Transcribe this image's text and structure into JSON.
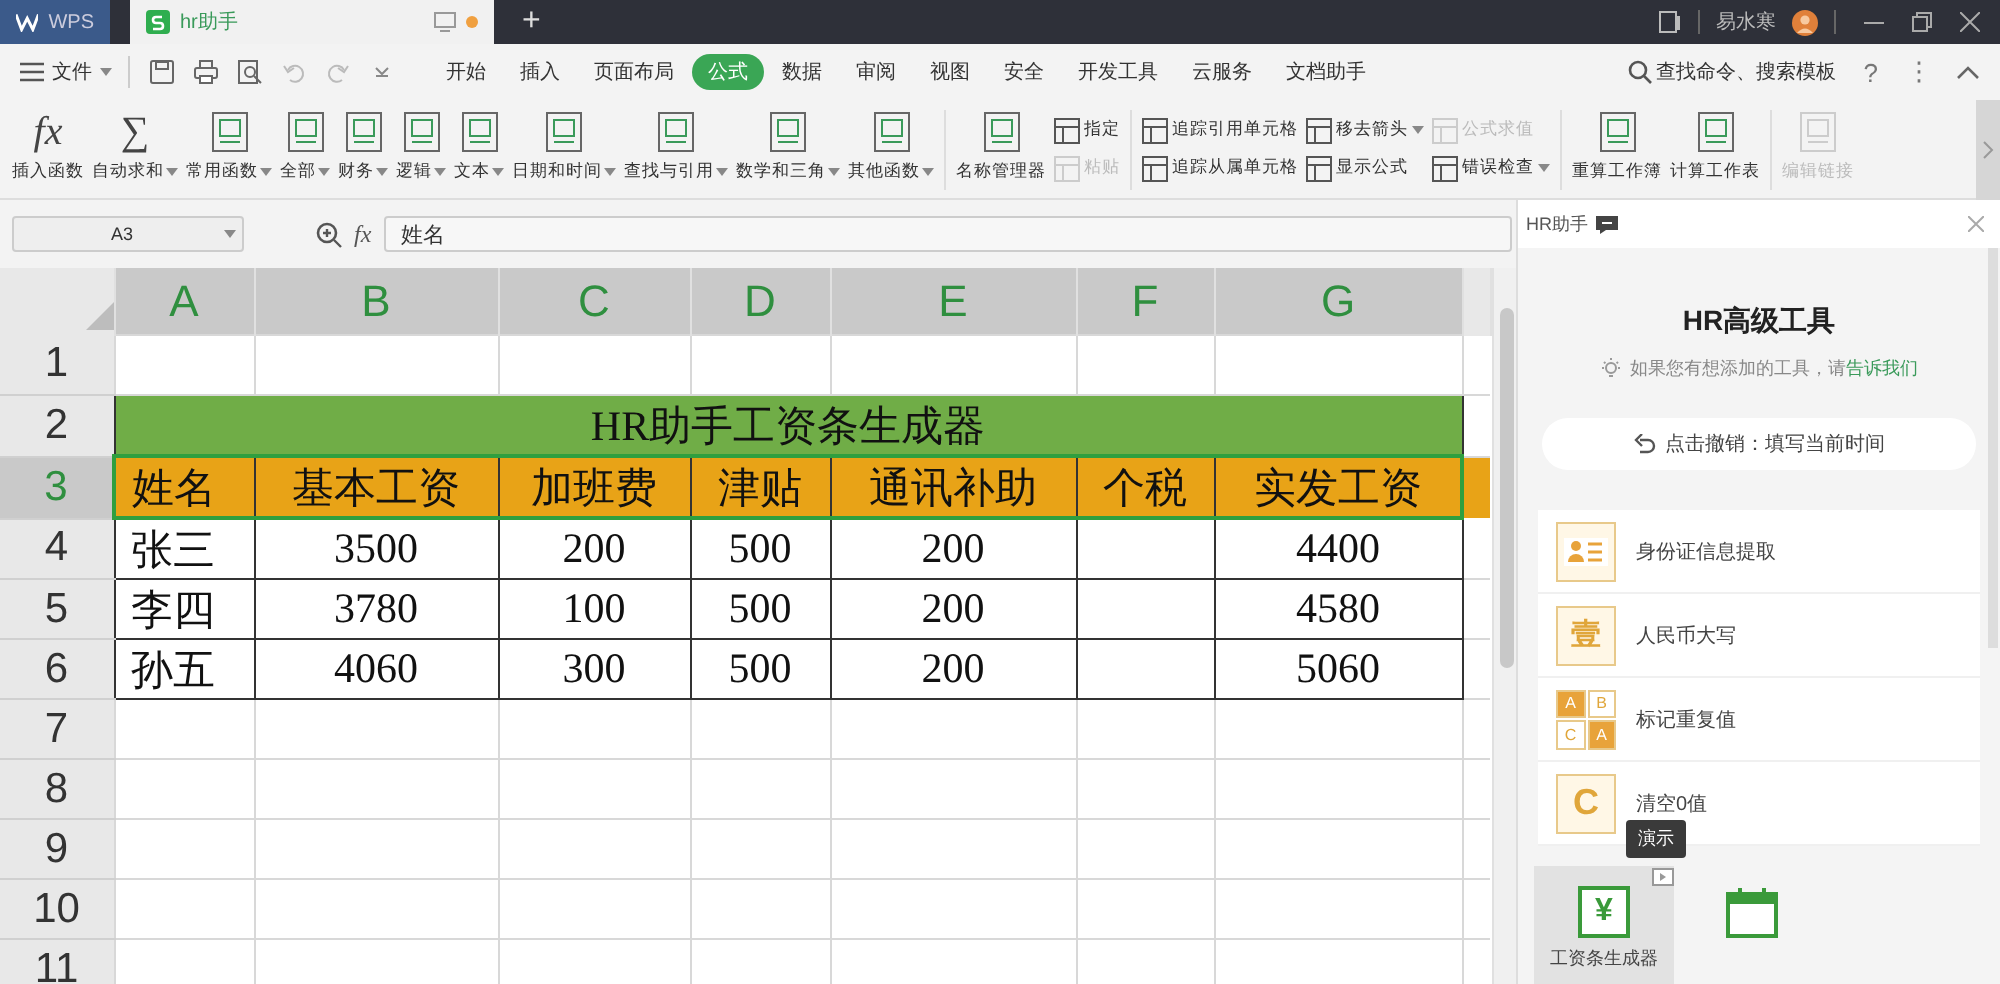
{
  "title_bar": {
    "tabs": [
      {
        "label": "WPS",
        "selected": false
      },
      {
        "label": "hr助手",
        "selected": true
      }
    ],
    "new_tab": "+",
    "user": "易水寒"
  },
  "menu": {
    "file": "文件",
    "tabs": [
      {
        "label": "开始",
        "selected": false
      },
      {
        "label": "插入",
        "selected": false
      },
      {
        "label": "页面布局",
        "selected": false
      },
      {
        "label": "公式",
        "selected": true
      },
      {
        "label": "数据",
        "selected": false
      },
      {
        "label": "审阅",
        "selected": false
      },
      {
        "label": "视图",
        "selected": false
      },
      {
        "label": "安全",
        "selected": false
      },
      {
        "label": "开发工具",
        "selected": false
      },
      {
        "label": "云服务",
        "selected": false
      },
      {
        "label": "文档助手",
        "selected": false
      }
    ],
    "search": "查找命令、搜索模板",
    "help": "?",
    "more": "⋮"
  },
  "ribbon": [
    {
      "kind": "glyph",
      "glyph": "fx",
      "label": "插入函数",
      "dropdown": false
    },
    {
      "kind": "glyph",
      "glyph": "∑",
      "label": "自动求和",
      "dropdown": true
    },
    {
      "kind": "large",
      "label": "常用函数",
      "dropdown": true
    },
    {
      "kind": "large",
      "label": "全部",
      "dropdown": true
    },
    {
      "kind": "large",
      "label": "财务",
      "dropdown": true
    },
    {
      "kind": "large",
      "label": "逻辑",
      "dropdown": true
    },
    {
      "kind": "large",
      "label": "文本",
      "dropdown": true
    },
    {
      "kind": "large",
      "label": "日期和时间",
      "dropdown": true
    },
    {
      "kind": "large",
      "label": "查找与引用",
      "dropdown": true
    },
    {
      "kind": "large",
      "label": "数学和三角",
      "dropdown": true
    },
    {
      "kind": "large",
      "label": "其他函数",
      "dropdown": true
    },
    {
      "kind": "separator"
    },
    {
      "kind": "large",
      "label": "名称管理器",
      "dropdown": false
    },
    {
      "kind": "stack",
      "rows": [
        {
          "label": "指定",
          "disabled": false,
          "dropdown": false
        },
        {
          "label": "粘贴",
          "disabled": true,
          "dropdown": false
        }
      ]
    },
    {
      "kind": "separator"
    },
    {
      "kind": "stack",
      "rows": [
        {
          "label": "追踪引用单元格",
          "disabled": false,
          "dropdown": false
        },
        {
          "label": "追踪从属单元格",
          "disabled": false,
          "dropdown": false
        }
      ]
    },
    {
      "kind": "stack",
      "rows": [
        {
          "label": "移去箭头",
          "disabled": false,
          "dropdown": true
        },
        {
          "label": "显示公式",
          "disabled": false,
          "dropdown": false
        }
      ]
    },
    {
      "kind": "stack",
      "rows": [
        {
          "label": "公式求值",
          "disabled": true,
          "dropdown": false
        },
        {
          "label": "错误检查",
          "disabled": false,
          "dropdown": true
        }
      ]
    },
    {
      "kind": "separator"
    },
    {
      "kind": "large",
      "label": "重算工作簿",
      "dropdown": false
    },
    {
      "kind": "large",
      "label": "计算工作表",
      "dropdown": false
    },
    {
      "kind": "separator"
    },
    {
      "kind": "large",
      "label": "编辑链接",
      "dropdown": false,
      "disabled": true
    }
  ],
  "formula_bar": {
    "name_box": "A3",
    "fx": "fx",
    "formula": "姓名"
  },
  "sheet": {
    "columns": [
      "A",
      "B",
      "C",
      "D",
      "E",
      "F",
      "G"
    ],
    "rows": [
      {
        "header": "1",
        "kind": "blank",
        "selected": false
      },
      {
        "header": "2",
        "kind": "title",
        "text": "HR助手工资条生成器",
        "selected": false
      },
      {
        "header": "3",
        "kind": "header",
        "selected": true,
        "cells": [
          "姓名",
          "基本工资",
          "加班费",
          "津贴",
          "通讯补助",
          "个税",
          "实发工资"
        ]
      },
      {
        "header": "4",
        "kind": "data",
        "selected": false,
        "cells": [
          "张三",
          "3500",
          "200",
          "500",
          "200",
          null,
          "4400"
        ]
      },
      {
        "header": "5",
        "kind": "data",
        "selected": false,
        "cells": [
          "李四",
          "3780",
          "100",
          "500",
          "200",
          null,
          "4580"
        ]
      },
      {
        "header": "6",
        "kind": "data",
        "selected": false,
        "cells": [
          "孙五",
          "4060",
          "300",
          "500",
          "200",
          null,
          "5060"
        ]
      },
      {
        "header": "7",
        "kind": "blank",
        "selected": false
      },
      {
        "header": "8",
        "kind": "blank",
        "selected": false
      },
      {
        "header": "9",
        "kind": "blank",
        "selected": false
      },
      {
        "header": "10",
        "kind": "blank",
        "selected": false
      },
      {
        "header": "11",
        "kind": "blank",
        "selected": false
      }
    ]
  },
  "panel": {
    "title": "HR助手",
    "heading": "HR高级工具",
    "hint": "如果您有想添加的工具，请",
    "hint_link": "告诉我们",
    "undo_button": "点击撤销：填写当前时间",
    "tools": [
      {
        "kind": "id",
        "label": "身份证信息提取"
      },
      {
        "kind": "char",
        "glyphs": [
          "壹"
        ],
        "label": "人民币大写"
      },
      {
        "kind": "grid",
        "glyphs": [
          "A",
          "B",
          "C",
          "A"
        ],
        "label": "标记重复值"
      },
      {
        "kind": "letter",
        "glyphs": [
          "C"
        ],
        "label": "清空0值"
      }
    ],
    "tooltip": "演示",
    "tiles": [
      {
        "kind": "money",
        "glyph": "¥",
        "label": "工资条生成器",
        "selected": true
      },
      {
        "kind": "calendar",
        "selected": false
      }
    ]
  }
}
